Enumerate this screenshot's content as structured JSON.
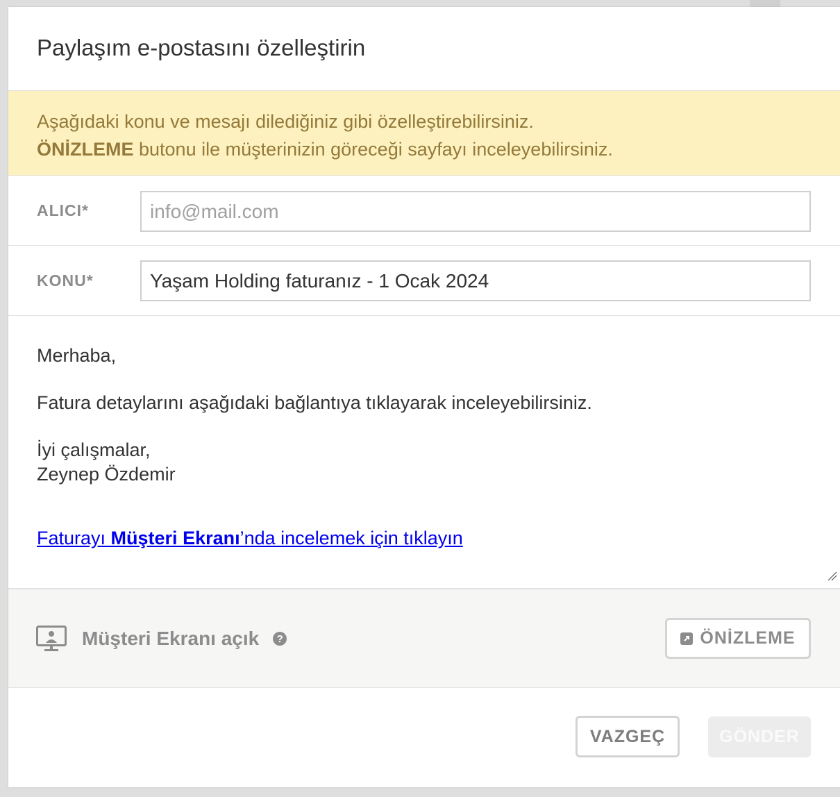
{
  "modal": {
    "title": "Paylaşım e-postasını özelleştirin"
  },
  "notice": {
    "line1": "Aşağıdaki konu ve mesajı dilediğiniz gibi özelleştirebilirsiniz.",
    "line2_bold": "ÖNİZLEME",
    "line2_rest": " butonu ile müşterinizin göreceği sayfayı inceleyebilirsiniz."
  },
  "fields": {
    "recipient": {
      "label": "ALICI*",
      "value": "",
      "placeholder": "info@mail.com"
    },
    "subject": {
      "label": "KONU*",
      "value": "Yaşam Holding faturanız - 1 Ocak 2024"
    }
  },
  "message": {
    "greeting": "Merhaba,",
    "body": "Fatura detaylarını aşağıdaki bağlantıya tıklayarak inceleyebilirsiniz.",
    "closing": "İyi çalışmalar,",
    "signature": "Zeynep Özdemir",
    "link_prefix": "Faturayı ",
    "link_bold": "Müşteri Ekranı",
    "link_suffix": "’nda incelemek için tıklayın"
  },
  "customer_screen": {
    "icon": "monitor-user-icon",
    "label": "Müşteri Ekranı açık",
    "help_icon": "question-circle-icon",
    "help_glyph": "?",
    "preview_button": "ÖNİZLEME",
    "preview_icon": "external-link-icon"
  },
  "footer": {
    "cancel_button": "VAZGEÇ",
    "send_button": "GÖNDER"
  },
  "colors": {
    "notice_bg": "#fdf2bf",
    "notice_text": "#94793a",
    "link": "#0000ee",
    "muted": "#8c8c8c"
  }
}
